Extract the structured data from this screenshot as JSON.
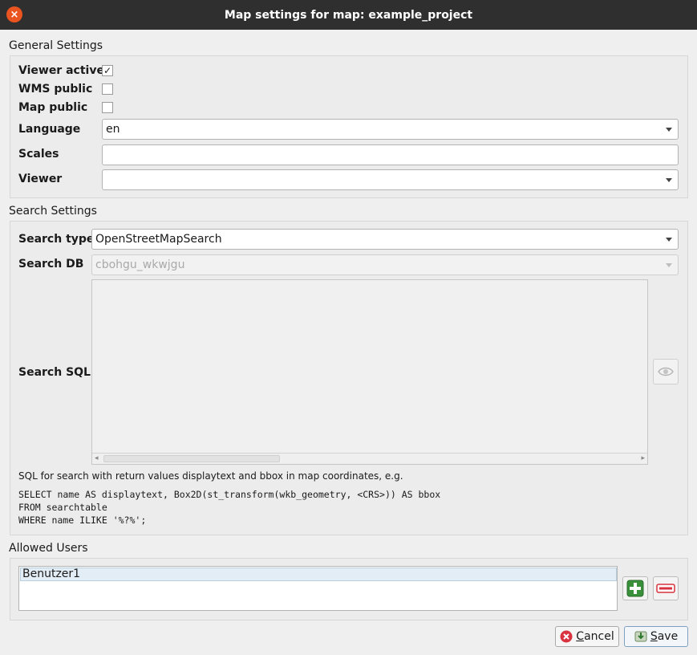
{
  "window": {
    "title": "Map settings for map: example_project"
  },
  "general": {
    "section_title": "General Settings",
    "viewer_active_label": "Viewer active",
    "viewer_active_checked": "✓",
    "wms_public_label": "WMS public",
    "map_public_label": "Map public",
    "language_label": "Language",
    "language_value": "en",
    "scales_label": "Scales",
    "scales_value": "",
    "viewer_label": "Viewer",
    "viewer_value": ""
  },
  "search": {
    "section_title": "Search Settings",
    "type_label": "Search type",
    "type_value": "OpenStreetMapSearch",
    "db_label": "Search DB",
    "db_value": "cbohgu_wkwjgu",
    "sql_label": "Search SQL",
    "scroll_left": "◂",
    "scroll_right": "▸",
    "hint": "SQL for search with return values displaytext and bbox in map coordinates, e.g.",
    "example_lines": [
      "SELECT name AS displaytext, Box2D(st_transform(wkb_geometry, <CRS>)) AS bbox",
      "FROM searchtable",
      "WHERE name ILIKE '%?%';"
    ]
  },
  "users": {
    "section_title": "Allowed Users",
    "items": [
      "Benutzer1"
    ]
  },
  "buttons": {
    "cancel_first": "C",
    "cancel_rest": "ancel",
    "save_first": "S",
    "save_rest": "ave"
  },
  "icons": {
    "close": "×"
  },
  "colors": {
    "close_button": "#e95420",
    "add_green": "#3a8f3a",
    "remove_red": "#d9333f"
  }
}
